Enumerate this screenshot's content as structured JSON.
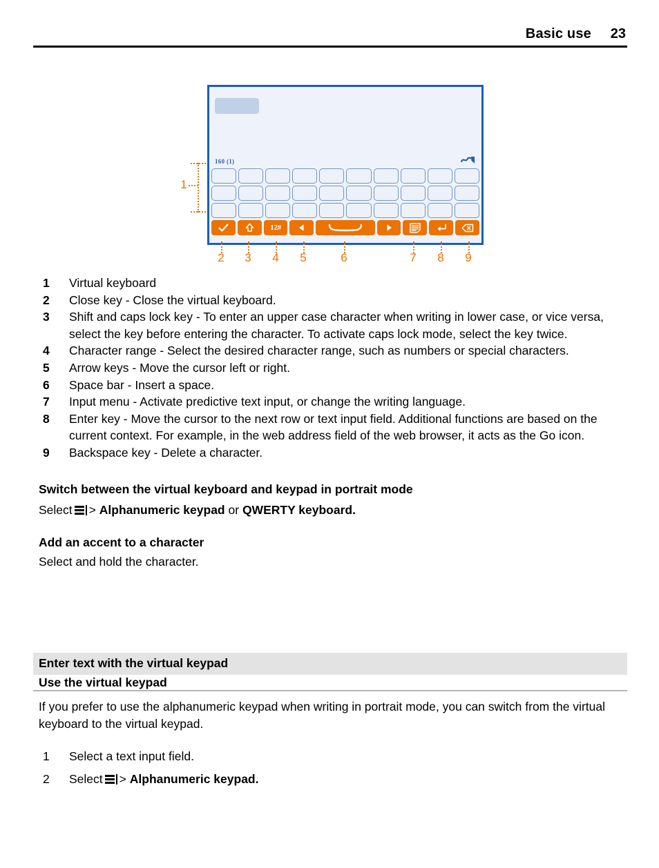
{
  "header": {
    "title": "Basic use",
    "page_number": "23"
  },
  "figure": {
    "name": "virtual-keyboard-diagram",
    "screen": {
      "char_count": "160 (1)",
      "message_icon": "envelope-icon",
      "selected_field": "text-input-field"
    },
    "key_rows": [
      10,
      10,
      10
    ],
    "function_keys": [
      {
        "name": "close-key",
        "glyph": "✓",
        "callout": "2"
      },
      {
        "name": "shift-caps-lock-key",
        "glyph": "⇧",
        "callout": "3"
      },
      {
        "name": "character-range-key",
        "glyph": "12#",
        "callout": "4"
      },
      {
        "name": "arrow-left-key",
        "glyph": "◀",
        "callout": "5"
      },
      {
        "name": "space-bar-key",
        "glyph": "⌣",
        "callout": "6"
      },
      {
        "name": "arrow-right-key",
        "glyph": "▶",
        "callout": ""
      },
      {
        "name": "input-menu-key",
        "glyph": "☰",
        "callout": "7"
      },
      {
        "name": "enter-key",
        "glyph": "↵",
        "callout": "8"
      },
      {
        "name": "backspace-key",
        "glyph": "⌫",
        "callout": "9"
      }
    ],
    "callouts": {
      "keyboard": "1",
      "numbers": [
        "2",
        "3",
        "4",
        "5",
        "6",
        "7",
        "8",
        "9"
      ]
    },
    "accent_color": "#eb7203",
    "frame_color": "#1c5dbf"
  },
  "legend": [
    {
      "num": "1",
      "text": "Virtual keyboard"
    },
    {
      "num": "2",
      "text": "Close key - Close the virtual keyboard."
    },
    {
      "num": "3",
      "text": "Shift and caps lock key - To enter an upper case character when writing in lower case, or vice versa, select the key before entering the character. To activate caps lock mode, select the key twice."
    },
    {
      "num": "4",
      "text": "Character range - Select the desired character range, such as numbers or special characters."
    },
    {
      "num": "5",
      "text": "Arrow keys - Move the cursor left or right."
    },
    {
      "num": "6",
      "text": "Space bar - Insert a space."
    },
    {
      "num": "7",
      "text": "Input menu - Activate predictive text input, or change the writing language."
    },
    {
      "num": "8",
      "text": "Enter key - Move the cursor to the next row or text input field. Additional functions are based on the current context. For example, in the web address field of the web browser, it acts as the Go icon."
    },
    {
      "num": "9",
      "text": "Backspace key - Delete a character."
    }
  ],
  "sections": {
    "switch_mode": {
      "heading": "Switch between the virtual keyboard and keypad in portrait mode",
      "select_word": "Select",
      "separator": ">",
      "option_one": "Alphanumeric keypad",
      "conjunction": "or",
      "option_two": "QWERTY keyboard",
      "period": "."
    },
    "accent": {
      "heading": "Add an accent to a character",
      "body": "Select and hold the character."
    },
    "keypad": {
      "banner": "Enter text with the virtual keypad",
      "subheading": "Use the virtual keypad",
      "intro": "If you prefer to use the alphanumeric keypad when writing in portrait mode, you can switch from the virtual keyboard to the virtual keypad.",
      "steps": [
        {
          "num": "1",
          "text": "Select a text input field."
        },
        {
          "num": "2",
          "select_word": "Select",
          "separator": ">",
          "target": "Alphanumeric keypad",
          "period": "."
        }
      ]
    }
  }
}
